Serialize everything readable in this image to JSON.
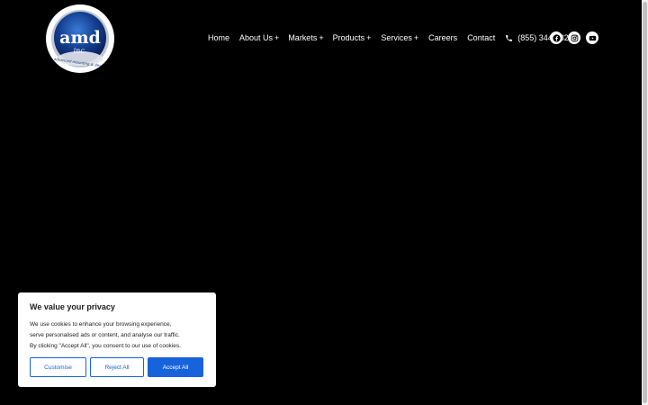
{
  "header": {
    "logo": {
      "main_text": "amd",
      "sub_text": "inc.",
      "tagline": "advanced mounting & design"
    },
    "nav": [
      {
        "label": "Home",
        "has_submenu": false
      },
      {
        "label": "About Us",
        "has_submenu": true
      },
      {
        "label": "Markets",
        "has_submenu": true
      },
      {
        "label": "Products",
        "has_submenu": true
      },
      {
        "label": "Services",
        "has_submenu": true
      },
      {
        "label": "Careers",
        "has_submenu": false
      },
      {
        "label": "Contact",
        "has_submenu": false
      }
    ],
    "submenu_indicator": "+",
    "phone": "(855) 344-1822",
    "socials": [
      "facebook-icon",
      "instagram-icon",
      "youtube-icon"
    ]
  },
  "cookie_banner": {
    "title": "We value your privacy",
    "line1": "We use cookies to enhance your browsing experience,",
    "line2": "serve personalised ads or content, and analyse our traffic.",
    "line3": "By clicking \"Accept All\", you consent to our use of cookies.",
    "customise_label": "Customise",
    "reject_label": "Reject All",
    "accept_label": "Accept All"
  },
  "colors": {
    "background": "#000000",
    "accent": "#1863dc",
    "logo_blue": "#0b3d91"
  }
}
